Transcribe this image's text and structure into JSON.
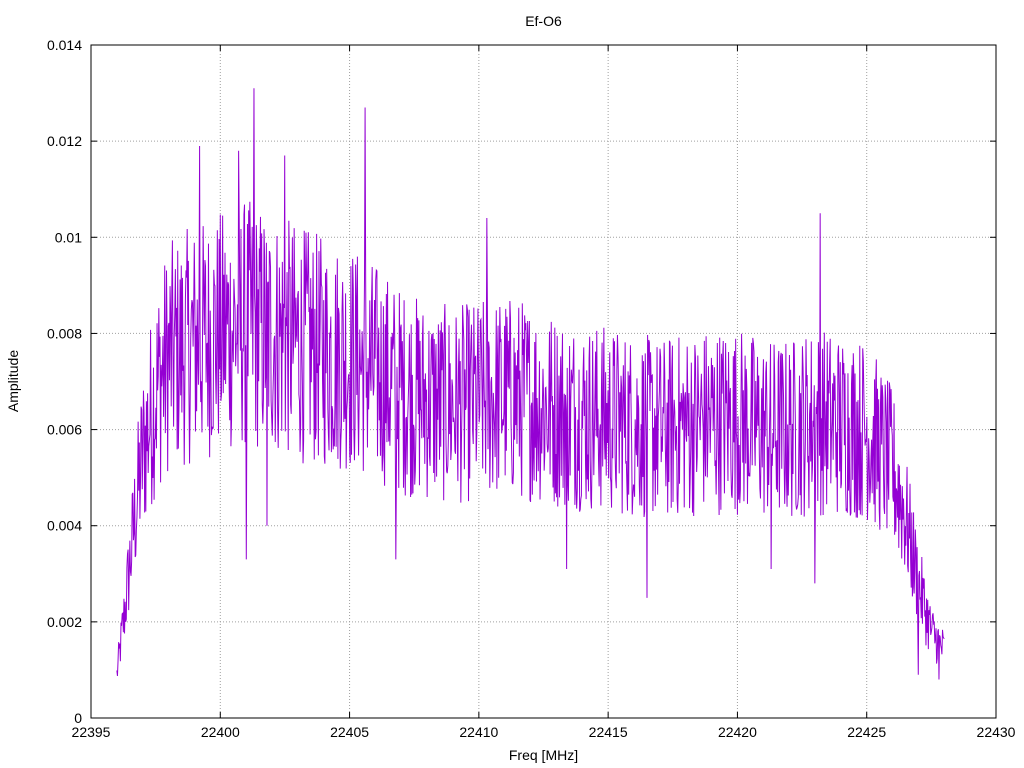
{
  "chart_data": {
    "type": "line",
    "title": "Ef-O6",
    "xlabel": "Freq [MHz]",
    "ylabel": "Amplitude",
    "xlim": [
      22395,
      22430
    ],
    "ylim": [
      0,
      0.014
    ],
    "xticks": [
      "22395",
      "22400",
      "22405",
      "22410",
      "22415",
      "22420",
      "22425",
      "22430"
    ],
    "yticks": [
      "0",
      "0.002",
      "0.004",
      "0.006",
      "0.008",
      "0.01",
      "0.012",
      "0.014"
    ],
    "grid": true,
    "legend": "none",
    "series": [
      {
        "color": "#9400d3",
        "x_range": [
          22396.0,
          22428.0
        ],
        "envelope": {
          "x": [
            22396.0,
            22396.3,
            22396.7,
            22397.0,
            22397.5,
            22398.0,
            22399.0,
            22400.0,
            22401.0,
            22402.0,
            22403.0,
            22404.0,
            22405.0,
            22406.0,
            22407.0,
            22408.0,
            22409.0,
            22410.0,
            22411.0,
            22412.0,
            22413.0,
            22414.0,
            22415.0,
            22416.0,
            22417.0,
            22418.0,
            22419.0,
            22420.0,
            22421.0,
            22422.0,
            22423.0,
            22424.0,
            22425.0,
            22426.0,
            22426.5,
            22427.0,
            22427.5,
            22428.0
          ],
          "y": [
            0.0009,
            0.0022,
            0.0042,
            0.0055,
            0.0068,
            0.0075,
            0.0078,
            0.008,
            0.0082,
            0.008,
            0.0078,
            0.0076,
            0.0075,
            0.0072,
            0.0068,
            0.0066,
            0.0065,
            0.0066,
            0.0067,
            0.0066,
            0.0064,
            0.0063,
            0.0062,
            0.0061,
            0.006,
            0.0061,
            0.0062,
            0.0062,
            0.006,
            0.006,
            0.0062,
            0.0061,
            0.006,
            0.0052,
            0.0042,
            0.0028,
            0.0018,
            0.0014
          ]
        },
        "peaks": [
          {
            "x": 22399.2,
            "y": 0.0119
          },
          {
            "x": 22400.7,
            "y": 0.0118
          },
          {
            "x": 22401.3,
            "y": 0.0131
          },
          {
            "x": 22402.5,
            "y": 0.0117
          },
          {
            "x": 22405.6,
            "y": 0.0127
          },
          {
            "x": 22410.3,
            "y": 0.0104
          },
          {
            "x": 22423.2,
            "y": 0.0105
          }
        ],
        "dips": [
          {
            "x": 22401.0,
            "y": 0.0033
          },
          {
            "x": 22401.8,
            "y": 0.004
          },
          {
            "x": 22406.8,
            "y": 0.0033
          },
          {
            "x": 22413.4,
            "y": 0.0031
          },
          {
            "x": 22416.5,
            "y": 0.0025
          },
          {
            "x": 22421.3,
            "y": 0.0031
          },
          {
            "x": 22423.0,
            "y": 0.0028
          },
          {
            "x": 22427.0,
            "y": 0.0009
          },
          {
            "x": 22427.8,
            "y": 0.0008
          }
        ]
      }
    ]
  }
}
